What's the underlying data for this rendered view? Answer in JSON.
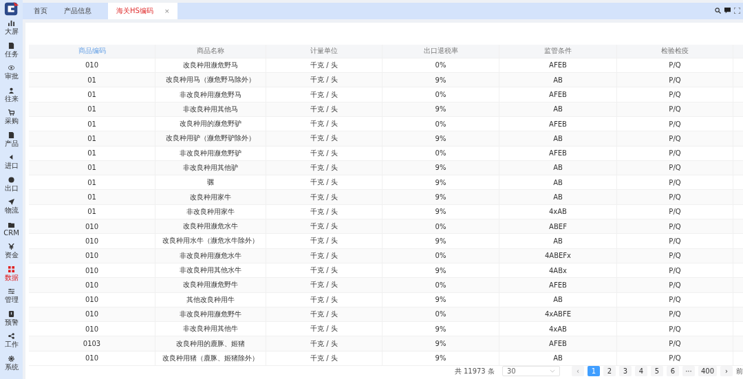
{
  "sidebar": {
    "items": [
      {
        "label": "大屏",
        "selected": false
      },
      {
        "label": "任务",
        "selected": false
      },
      {
        "label": "审批",
        "selected": false
      },
      {
        "label": "往来",
        "selected": false
      },
      {
        "label": "采购",
        "selected": false
      },
      {
        "label": "产品",
        "selected": false
      },
      {
        "label": "进口",
        "selected": false
      },
      {
        "label": "出口",
        "selected": false
      },
      {
        "label": "物流",
        "selected": false
      },
      {
        "label": "CRM",
        "selected": false
      },
      {
        "label": "资金",
        "selected": false
      },
      {
        "label": "数据",
        "selected": true
      },
      {
        "label": "管理",
        "selected": false
      },
      {
        "label": "预警",
        "selected": false
      },
      {
        "label": "工作",
        "selected": false
      },
      {
        "label": "系统",
        "selected": false
      }
    ]
  },
  "tabs": [
    {
      "label": "首页",
      "selected": false
    },
    {
      "label": "产品信息",
      "selected": false
    },
    {
      "label": "海关HS编码",
      "selected": true,
      "close": "×"
    }
  ],
  "table": {
    "columns": [
      "商品编码",
      "商品名称",
      "计量单位",
      "出口退税率",
      "监管条件",
      "检验检疫"
    ],
    "rows": [
      {
        "code": "010",
        "name": "改良种用濒危野马",
        "unit": "千克 / 头",
        "rate": "0%",
        "condition": "AFEB",
        "inspection": "P/Q"
      },
      {
        "code": "01",
        "name": "改良种用马（濒危野马除外）",
        "unit": "千克 / 头",
        "rate": "9%",
        "condition": "AB",
        "inspection": "P/Q"
      },
      {
        "code": "01",
        "name": "非改良种用濒危野马",
        "unit": "千克 / 头",
        "rate": "0%",
        "condition": "AFEB",
        "inspection": "P/Q"
      },
      {
        "code": "01",
        "name": "非改良种用其他马",
        "unit": "千克 / 头",
        "rate": "9%",
        "condition": "AB",
        "inspection": "P/Q"
      },
      {
        "code": "01",
        "name": "改良种用的濒危野驴",
        "unit": "千克 / 头",
        "rate": "0%",
        "condition": "AFEB",
        "inspection": "P/Q"
      },
      {
        "code": "01",
        "name": "改良种用驴（濒危野驴除外）",
        "unit": "千克 / 头",
        "rate": "9%",
        "condition": "AB",
        "inspection": "P/Q"
      },
      {
        "code": "01",
        "name": "非改良种用濒危野驴",
        "unit": "千克 / 头",
        "rate": "0%",
        "condition": "AFEB",
        "inspection": "P/Q"
      },
      {
        "code": "01",
        "name": "非改良种用其他驴",
        "unit": "千克 / 头",
        "rate": "9%",
        "condition": "AB",
        "inspection": "P/Q"
      },
      {
        "code": "01",
        "name": "骡",
        "unit": "千克 / 头",
        "rate": "9%",
        "condition": "AB",
        "inspection": "P/Q"
      },
      {
        "code": "01",
        "name": "改良种用家牛",
        "unit": "千克 / 头",
        "rate": "9%",
        "condition": "AB",
        "inspection": "P/Q"
      },
      {
        "code": "01",
        "name": "非改良种用家牛",
        "unit": "千克 / 头",
        "rate": "9%",
        "condition": "4xAB",
        "inspection": "P/Q"
      },
      {
        "code": "010",
        "name": "改良种用濒危水牛",
        "unit": "千克 / 头",
        "rate": "0%",
        "condition": "ABEF",
        "inspection": "P/Q"
      },
      {
        "code": "010",
        "name": "改良种用水牛（濒危水牛除外）",
        "unit": "千克 / 头",
        "rate": "9%",
        "condition": "AB",
        "inspection": "P/Q"
      },
      {
        "code": "010",
        "name": "非改良种用濒危水牛",
        "unit": "千克 / 头",
        "rate": "0%",
        "condition": "4ABEFx",
        "inspection": "P/Q"
      },
      {
        "code": "010",
        "name": "非改良种用其他水牛",
        "unit": "千克 / 头",
        "rate": "9%",
        "condition": "4ABx",
        "inspection": "P/Q"
      },
      {
        "code": "010",
        "name": "改良种用濒危野牛",
        "unit": "千克 / 头",
        "rate": "0%",
        "condition": "AFEB",
        "inspection": "P/Q"
      },
      {
        "code": "010",
        "name": "其他改良种用牛",
        "unit": "千克 / 头",
        "rate": "9%",
        "condition": "AB",
        "inspection": "P/Q"
      },
      {
        "code": "010",
        "name": "非改良种用濒危野牛",
        "unit": "千克 / 头",
        "rate": "0%",
        "condition": "4xABFE",
        "inspection": "P/Q"
      },
      {
        "code": "010",
        "name": "非改良种用其他牛",
        "unit": "千克 / 头",
        "rate": "9%",
        "condition": "4xAB",
        "inspection": "P/Q"
      },
      {
        "code": "0103",
        "name": "改良种用的鹿豚、姬猪",
        "unit": "千克 / 头",
        "rate": "9%",
        "condition": "AFEB",
        "inspection": "P/Q"
      },
      {
        "code": "010",
        "name": "改良种用猪（鹿豚、姬猪除外）",
        "unit": "千克 / 头",
        "rate": "9%",
        "condition": "AB",
        "inspection": "P/Q"
      }
    ]
  },
  "pagination": {
    "total": "共 11973 条",
    "page_size": "30",
    "prev": "‹",
    "next": "›",
    "goto": "前",
    "pages": [
      {
        "label": "1",
        "selected": true
      },
      {
        "label": "2",
        "selected": false
      },
      {
        "label": "3",
        "selected": false
      },
      {
        "label": "4",
        "selected": false
      },
      {
        "label": "5",
        "selected": false
      },
      {
        "label": "6",
        "selected": false
      },
      {
        "label": "···",
        "selected": false
      },
      {
        "label": "400",
        "selected": false
      }
    ]
  }
}
